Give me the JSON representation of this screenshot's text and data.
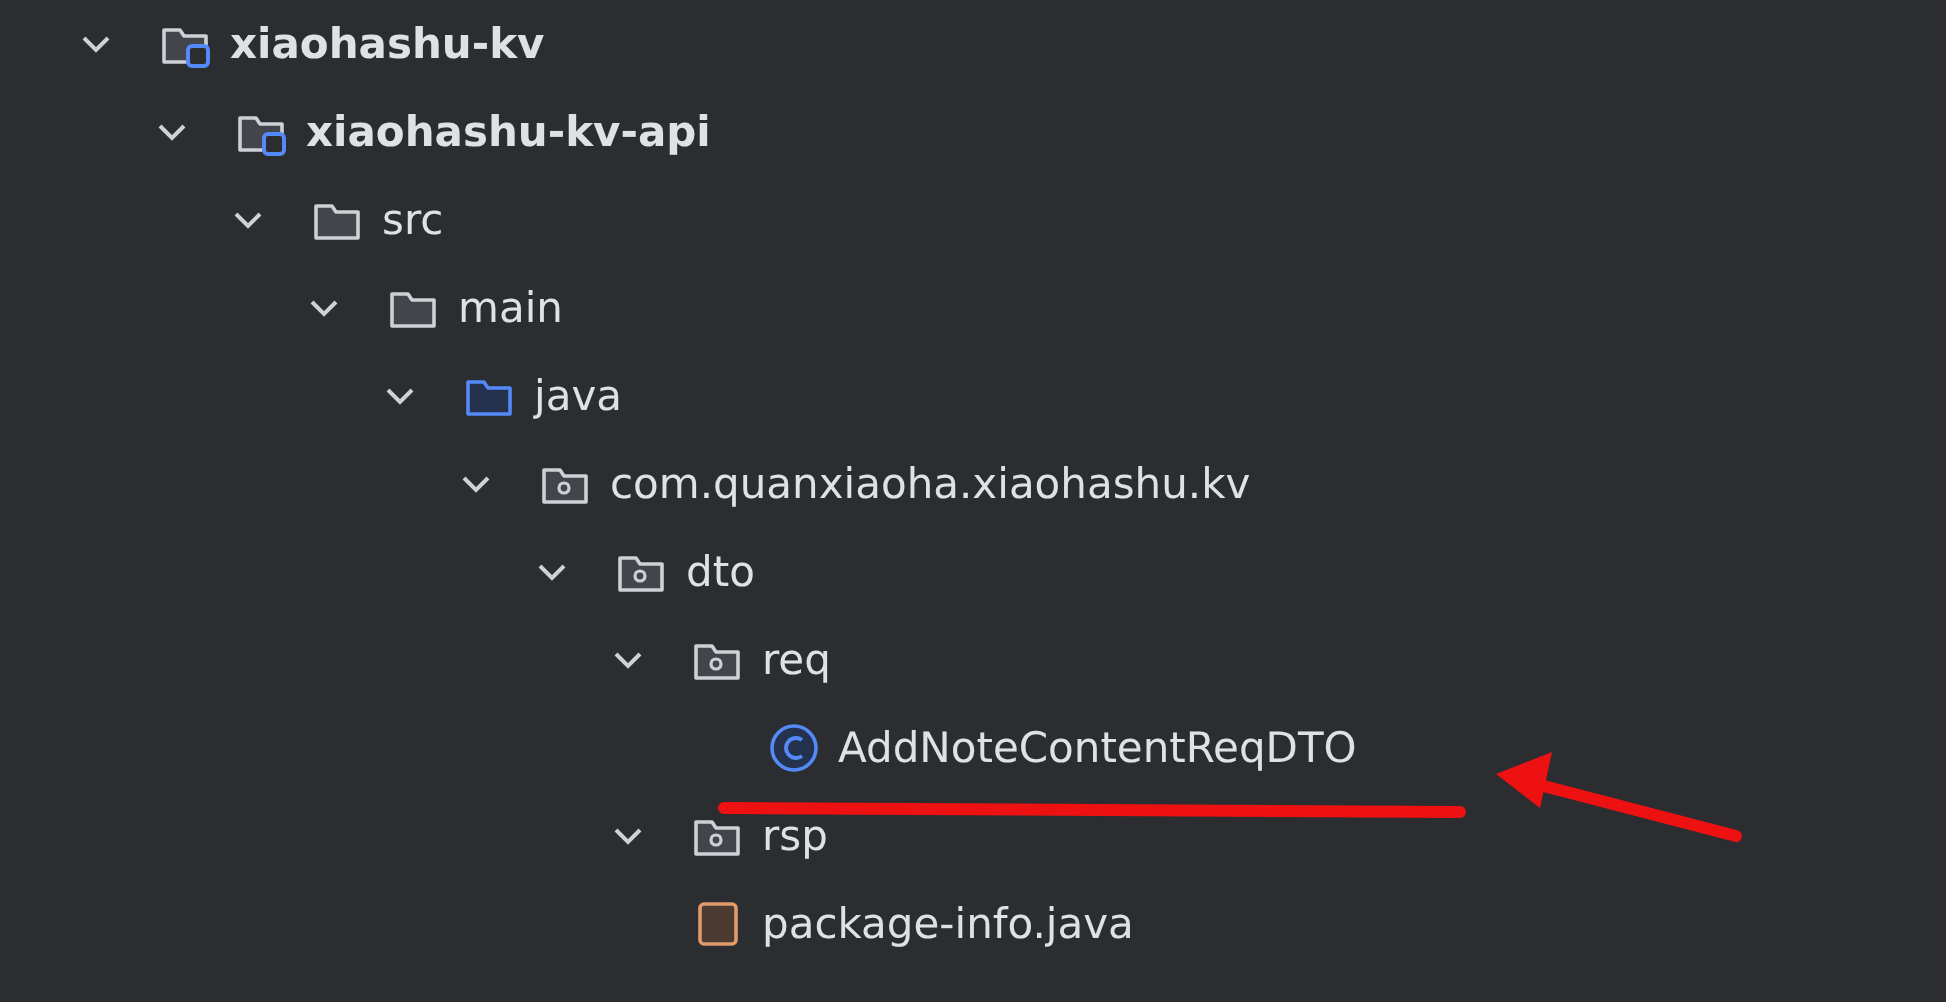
{
  "project_tree": {
    "items": [
      {
        "kind": "module",
        "label": "xiaohashu-kv",
        "expanded": true,
        "children": [
          {
            "kind": "module",
            "label": "xiaohashu-kv-api",
            "expanded": true,
            "children": [
              {
                "kind": "folder",
                "label": "src",
                "expanded": true,
                "children": [
                  {
                    "kind": "folder",
                    "label": "main",
                    "expanded": true,
                    "children": [
                      {
                        "kind": "source-folder",
                        "label": "java",
                        "expanded": true,
                        "children": [
                          {
                            "kind": "package",
                            "label": "com.quanxiaoha.xiaohashu.kv",
                            "expanded": true,
                            "children": [
                              {
                                "kind": "package",
                                "label": "dto",
                                "expanded": true,
                                "children": [
                                  {
                                    "kind": "package",
                                    "label": "req",
                                    "expanded": true,
                                    "children": [
                                      {
                                        "kind": "class",
                                        "label": "AddNoteContentReqDTO"
                                      }
                                    ]
                                  },
                                  {
                                    "kind": "package",
                                    "label": "rsp",
                                    "expanded": true
                                  },
                                  {
                                    "kind": "java-file",
                                    "label": "package-info.java"
                                  }
                                ]
                              }
                            ]
                          }
                        ]
                      }
                    ]
                  }
                ]
              }
            ]
          }
        ]
      }
    ]
  }
}
